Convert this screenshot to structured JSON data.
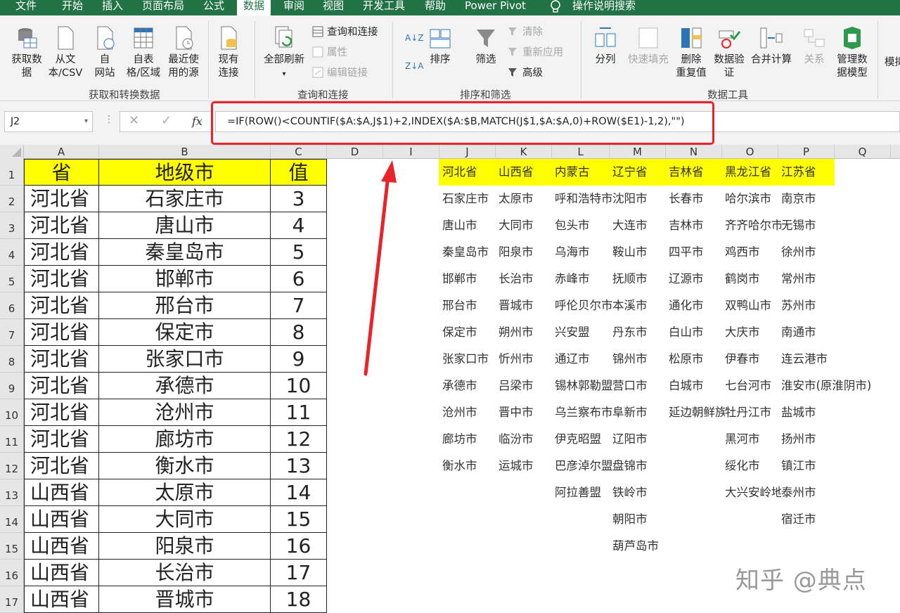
{
  "tabs": [
    "文件",
    "开始",
    "插入",
    "页面布局",
    "公式",
    "数据",
    "审阅",
    "视图",
    "开发工具",
    "帮助",
    "Power Pivot",
    "操作说明搜索"
  ],
  "ribbon": {
    "get_data": "获取数\n据",
    "from_text": "从文\n本/CSV",
    "from_web": "自\n网站",
    "from_table": "自表\n格/区域",
    "recent": "最近使\n用的源",
    "existing": "现有\n连接",
    "refresh_all": "全部刷新",
    "queries": "查询和连接",
    "properties": "属性",
    "edit_links": "编辑链接",
    "sort": "排序",
    "filter": "筛选",
    "clear": "清除",
    "reapply": "重新应用",
    "advanced": "高级",
    "split": "分列",
    "flash_fill": "快速填充",
    "remove_dup": "删除\n重复值",
    "validation": "数据验\n证",
    "consolidate": "合并计算",
    "relations": "关系",
    "data_model": "管理数\n据模型",
    "more": "模拟",
    "group1": "获取和转换数据",
    "group2": "查询和连接",
    "group3": "排序和筛选",
    "group4": "数据工具"
  },
  "name_box": "J2",
  "formula": "=IF(ROW()<COUNTIF($A:$A,J$1)+2,INDEX($A:$B,MATCH(J$1,$A:$A,0)+ROW($E1)-1,2),\"\")",
  "columns": [
    "A",
    "B",
    "C",
    "D",
    "I",
    "J",
    "K",
    "L",
    "M",
    "N",
    "O",
    "P",
    "Q"
  ],
  "rows": [
    "1",
    "2",
    "3",
    "4",
    "5",
    "6",
    "7",
    "8",
    "9",
    "10",
    "11",
    "12",
    "13",
    "14",
    "15",
    "16",
    "17"
  ],
  "table": {
    "headers": [
      "省",
      "地级市",
      "值"
    ],
    "data": [
      [
        "河北省",
        "石家庄市",
        "3"
      ],
      [
        "河北省",
        "唐山市",
        "4"
      ],
      [
        "河北省",
        "秦皇岛市",
        "5"
      ],
      [
        "河北省",
        "邯郸市",
        "6"
      ],
      [
        "河北省",
        "邢台市",
        "7"
      ],
      [
        "河北省",
        "保定市",
        "8"
      ],
      [
        "河北省",
        "张家口市",
        "9"
      ],
      [
        "河北省",
        "承德市",
        "10"
      ],
      [
        "河北省",
        "沧州市",
        "11"
      ],
      [
        "河北省",
        "廊坊市",
        "12"
      ],
      [
        "河北省",
        "衡水市",
        "13"
      ],
      [
        "山西省",
        "太原市",
        "14"
      ],
      [
        "山西省",
        "大同市",
        "15"
      ],
      [
        "山西省",
        "阳泉市",
        "16"
      ],
      [
        "山西省",
        "长治市",
        "17"
      ],
      [
        "山西省",
        "晋城市",
        "18"
      ]
    ]
  },
  "provinces": [
    "河北省",
    "山西省",
    "内蒙古",
    "辽宁省",
    "吉林省",
    "黑龙江省",
    "江苏省"
  ],
  "cities": [
    [
      "石家庄市",
      "唐山市",
      "秦皇岛市",
      "邯郸市",
      "邢台市",
      "保定市",
      "张家口市",
      "承德市",
      "沧州市",
      "廊坊市",
      "衡水市"
    ],
    [
      "太原市",
      "大同市",
      "阳泉市",
      "长治市",
      "晋城市",
      "朔州市",
      "忻州市",
      "吕梁市",
      "晋中市",
      "临汾市",
      "运城市"
    ],
    [
      "呼和浩特市",
      "包头市",
      "乌海市",
      "赤峰市",
      "呼伦贝尔市",
      "兴安盟",
      "通辽市",
      "锡林郭勒盟",
      "乌兰察布市",
      "伊克昭盟",
      "巴彦淖尔盟",
      "阿拉善盟"
    ],
    [
      "沈阳市",
      "大连市",
      "鞍山市",
      "抚顺市",
      "本溪市",
      "丹东市",
      "锦州市",
      "营口市",
      "阜新市",
      "辽阳市",
      "盘锦市",
      "铁岭市",
      "朝阳市",
      "葫芦岛市"
    ],
    [
      "长春市",
      "吉林市",
      "四平市",
      "辽源市",
      "通化市",
      "白山市",
      "松原市",
      "白城市",
      "延边朝鲜族自治州"
    ],
    [
      "哈尔滨市",
      "齐齐哈尔市",
      "鸡西市",
      "鹤岗市",
      "双鸭山市",
      "大庆市",
      "伊春市",
      "七台河市",
      "牡丹江市",
      "黑河市",
      "绥化市",
      "大兴安岭地区"
    ],
    [
      "南京市",
      "无锡市",
      "徐州市",
      "常州市",
      "苏州市",
      "南通市",
      "连云港市",
      "淮安市(原淮阴市)",
      "盐城市",
      "扬州市",
      "镇江市",
      "泰州市",
      "宿迁市"
    ]
  ],
  "watermark": "知乎 @典点",
  "colors": {
    "excel_green": "#217346",
    "highlight": "#ffff00",
    "annotation_red": "#e8232a"
  }
}
